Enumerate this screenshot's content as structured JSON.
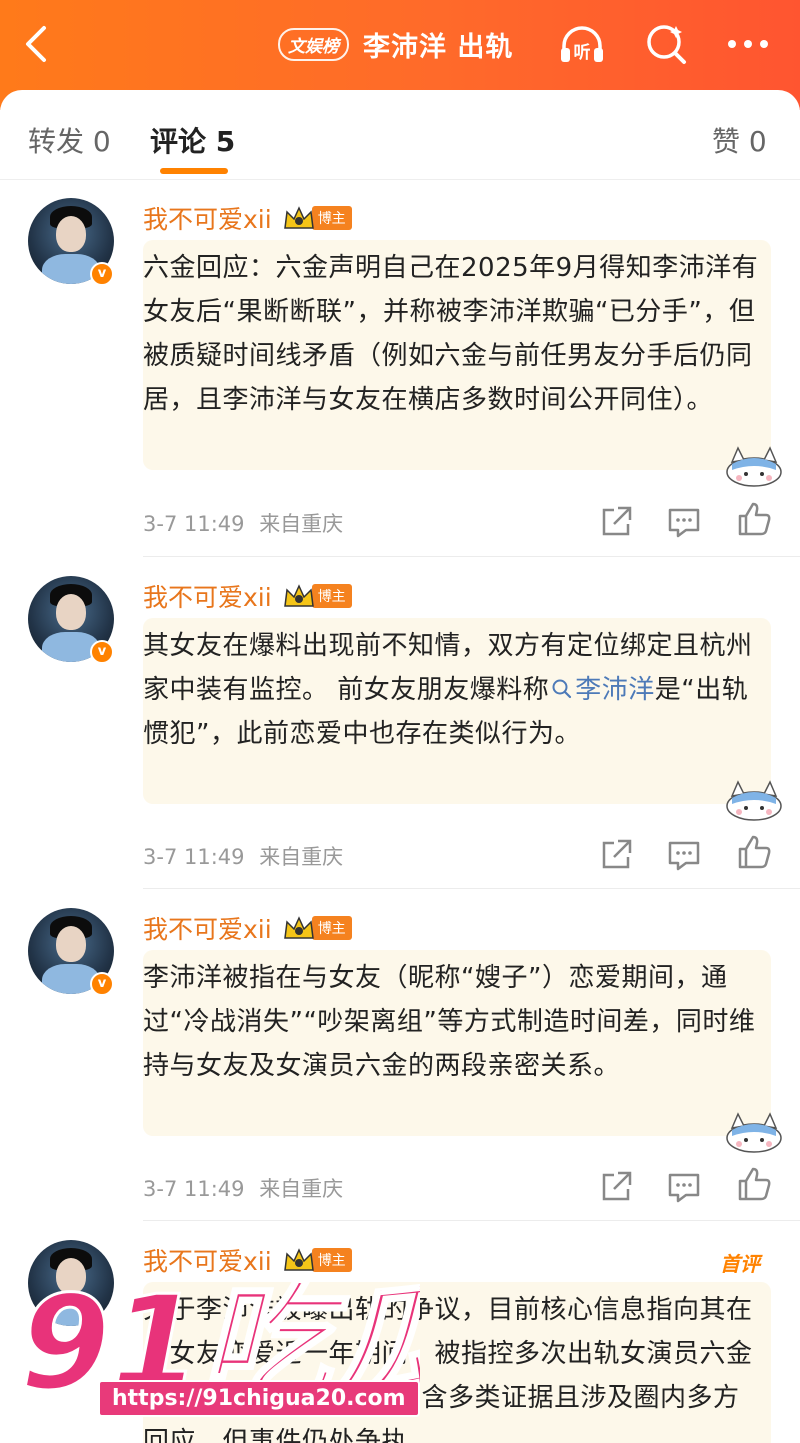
{
  "header": {
    "hot_badge": "文娱榜",
    "topic": "李沛洋 出轨",
    "listen_label": "听"
  },
  "tabs": [
    {
      "label": "转发 0"
    },
    {
      "label": "评论 5"
    },
    {
      "label": "赞 0"
    }
  ],
  "comments": [
    {
      "user": "我不可爱xii",
      "tag": "博主",
      "text": "六金回应：六金声明自己在2025年9月得知李沛洋有女友后“果断断联”，并称被李沛洋欺骗“已分手”，但被质疑时间线矛盾（例如六金与前任男友分手后仍同居，且李沛洋与女友在横店多数时间公开同住）。",
      "time": "3-7 11:49",
      "location": "来自重庆"
    },
    {
      "user": "我不可爱xii",
      "tag": "博主",
      "text_before": "其女友在爆料出现前不知情，双方有定位绑定且杭州家中装有监控。 前女友朋友爆料称",
      "link": "李沛洋",
      "text_after": "是“出轨惯犯”，此前恋爱中也存在类似行为。",
      "time": "3-7 11:49",
      "location": "来自重庆"
    },
    {
      "user": "我不可爱xii",
      "tag": "博主",
      "text": "李沛洋被指在与女友（昵称“嫂子”）恋爱期间，通过“冷战消失”“吵架离组”等方式制造时间差，同时维持与女友及女演员六金的两段亲密关系。",
      "time": "3-7 11:49",
      "location": "来自重庆"
    },
    {
      "user": "我不可爱xii",
      "tag": "博主",
      "first_label": "首评",
      "text": "关于李沛洋被曝出轨的争议，目前核心信息指向其在与女友恋爱近一年期间，被指控多次出轨女演员六金（黎晟萱），相关爆料包含多类证据且涉及圈内多方回应，但事件仍处争执"
    }
  ],
  "watermark": {
    "brand": "91吃瓜中心",
    "url": "https://91chigua20.com"
  },
  "colors": {
    "accent": "#ff8200",
    "username": "#e8761c",
    "link": "#4d7ab8"
  }
}
